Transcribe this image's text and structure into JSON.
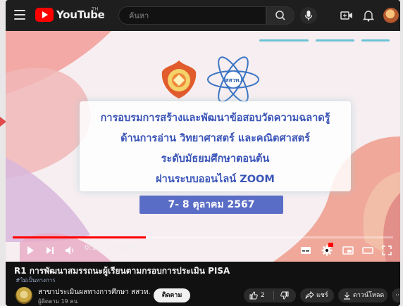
{
  "header": {
    "logo_text": "YouTube",
    "logo_sup": "TH",
    "search_placeholder": "ค้นหา"
  },
  "slide": {
    "lines": [
      "การอบรมการสร้างและพัฒนาข้อสอบวัดความฉลาดรู้",
      "ด้านการอ่าน วิทยาศาสตร์ และคณิตศาสตร์",
      "ระดับมัธยมศึกษาตอนต้น",
      "ผ่านระบบออนไลน์ ZOOM"
    ],
    "date": "7- 8 ตุลาคม 2567",
    "logo_right_text": "สสวท."
  },
  "player": {
    "time": "0:12 / 2:51:54",
    "progress_fraction": 0.35
  },
  "video": {
    "title": "R1 การพัฒนาสมรรถนะผู้เรียนตามกรอบการประเมิน PISA",
    "hashtag": "#ไม่เป็นทางการ",
    "channel_name": "สาขาประเมินผลทางการศึกษา สสวท.",
    "subscribers": "ผู้ติดตาม 19 คน",
    "subscribe_label": "ติดตาม",
    "like_count": "2",
    "share_label": "แชร์",
    "download_label": "ดาวน์โหลด"
  },
  "colors": {
    "brand_red": "#ff0000",
    "title_blue": "#3a55b8",
    "date_badge": "#5a6dc6"
  }
}
